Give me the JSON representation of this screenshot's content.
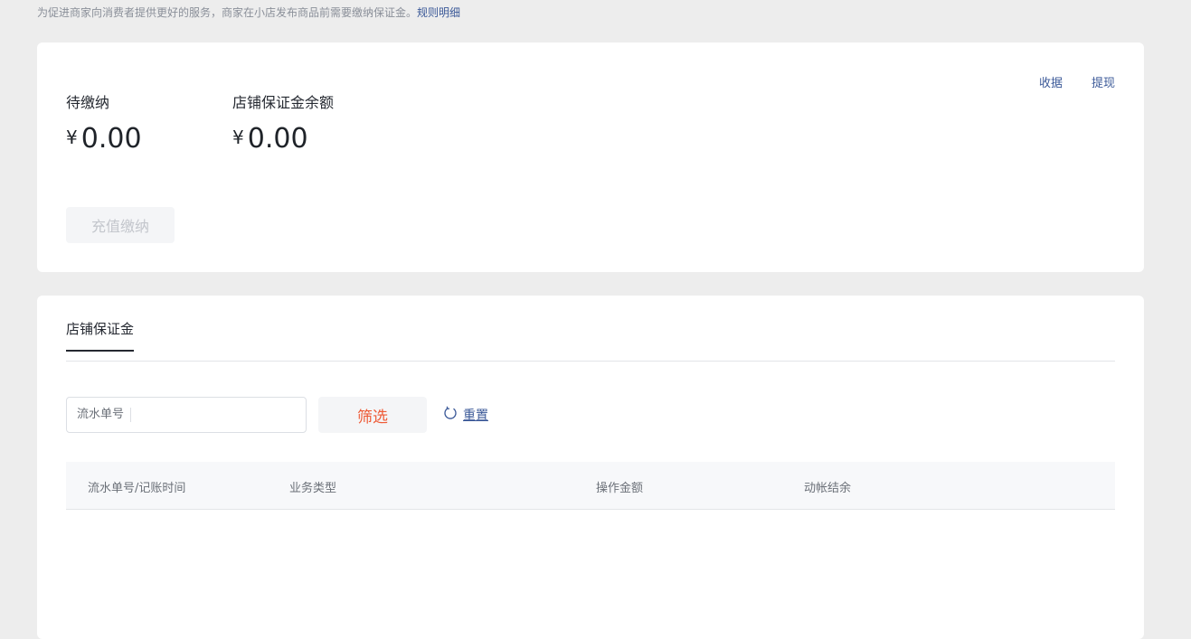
{
  "notice": {
    "text": "为促进商家向消费者提供更好的服务，商家在小店发布商品前需要缴纳保证金。",
    "link": "规则明细"
  },
  "summary": {
    "links": [
      "收据",
      "提现"
    ],
    "pending_label": "待缴纳",
    "pending_currency": "¥",
    "pending_value": "0.00",
    "balance_label": "店铺保证金余额",
    "balance_currency": "¥",
    "balance_value": "0.00",
    "recharge_button": "充值缴纳"
  },
  "records": {
    "tab": "店铺保证金",
    "search_label": "流水单号",
    "search_value": "",
    "filter_button": "筛选",
    "reset_button": "重置",
    "columns": [
      "流水单号/记账时间",
      "业务类型",
      "操作金额",
      "动帐结余"
    ]
  },
  "colors": {
    "accent": "#ee5a36",
    "link": "#3b5998",
    "background": "#ededed"
  },
  "icons": {
    "reset": "refresh-icon"
  }
}
